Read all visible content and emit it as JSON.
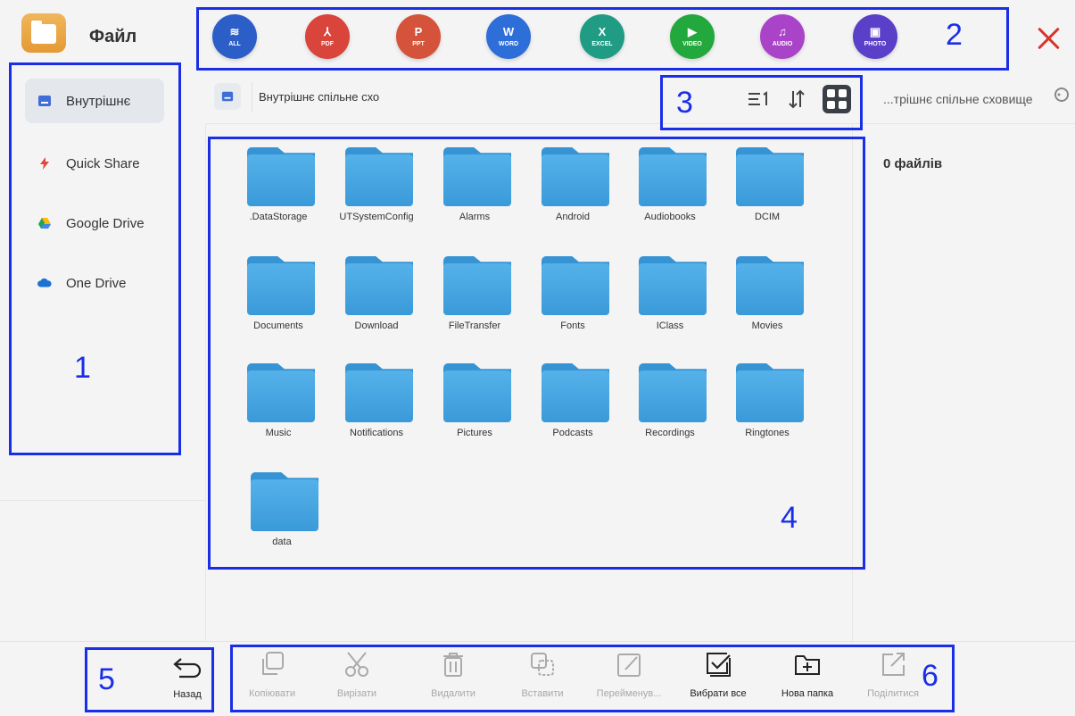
{
  "app": {
    "title": "Файл"
  },
  "filters": [
    {
      "label": "ALL",
      "glyph": "≋",
      "color": "#2c5ec8",
      "icon": "layers-icon"
    },
    {
      "label": "PDF",
      "glyph": "⅄",
      "color": "#d9443b",
      "icon": "pdf-icon"
    },
    {
      "label": "PPT",
      "glyph": "P",
      "color": "#d5533a",
      "icon": "ppt-icon"
    },
    {
      "label": "WORD",
      "glyph": "W",
      "color": "#2e6ed8",
      "icon": "word-icon"
    },
    {
      "label": "EXCEL",
      "glyph": "X",
      "color": "#1f9c83",
      "icon": "excel-icon"
    },
    {
      "label": "VIDEO",
      "glyph": "▶",
      "color": "#22a83c",
      "icon": "video-icon"
    },
    {
      "label": "AUDIO",
      "glyph": "♫",
      "color": "#a944c9",
      "icon": "audio-icon"
    },
    {
      "label": "PHOTO",
      "glyph": "▣",
      "color": "#5a3fc8",
      "icon": "photo-icon"
    }
  ],
  "sidebar": {
    "items": [
      {
        "label": "Внутрішнє",
        "icon": "storage-icon",
        "active": true
      },
      {
        "label": "Quick Share",
        "icon": "lightning-icon",
        "active": false
      },
      {
        "label": "Google Drive",
        "icon": "google-drive-icon",
        "active": false
      },
      {
        "label": "One Drive",
        "icon": "cloud-icon",
        "active": false
      }
    ]
  },
  "path": {
    "text": "Внутрішнє спільне схо"
  },
  "search": {
    "text": "...трішнє спільне сховище"
  },
  "info": {
    "file_count": "0 файлів"
  },
  "folders": [
    ".DataStorage",
    "UTSystemConfig",
    "Alarms",
    "Android",
    "Audiobooks",
    "DCIM",
    "Documents",
    "Download",
    "FileTransfer",
    "Fonts",
    "IClass",
    "Movies",
    "Music",
    "Notifications",
    "Pictures",
    "Podcasts",
    "Recordings",
    "Ringtones",
    "data"
  ],
  "bottom": {
    "back_label": "Назад",
    "actions": [
      {
        "label": "Копіювати",
        "icon": "copy-icon",
        "enabled": false
      },
      {
        "label": "Вирізати",
        "icon": "scissors-icon",
        "enabled": false
      },
      {
        "label": "Видалити",
        "icon": "trash-icon",
        "enabled": false
      },
      {
        "label": "Вставити",
        "icon": "paste-icon",
        "enabled": false
      },
      {
        "label": "Перейменув...",
        "icon": "rename-icon",
        "enabled": false
      },
      {
        "label": "Вибрати все",
        "icon": "select-all-icon",
        "enabled": true
      },
      {
        "label": "Нова папка",
        "icon": "new-folder-icon",
        "enabled": true
      },
      {
        "label": "Поділитися",
        "icon": "share-icon",
        "enabled": false
      }
    ]
  },
  "annotations": [
    "1",
    "2",
    "3",
    "4",
    "5",
    "6"
  ],
  "colors": {
    "annotation": "#1a2ee8",
    "folder": "#3a9ad9",
    "close": "#d9342b"
  }
}
